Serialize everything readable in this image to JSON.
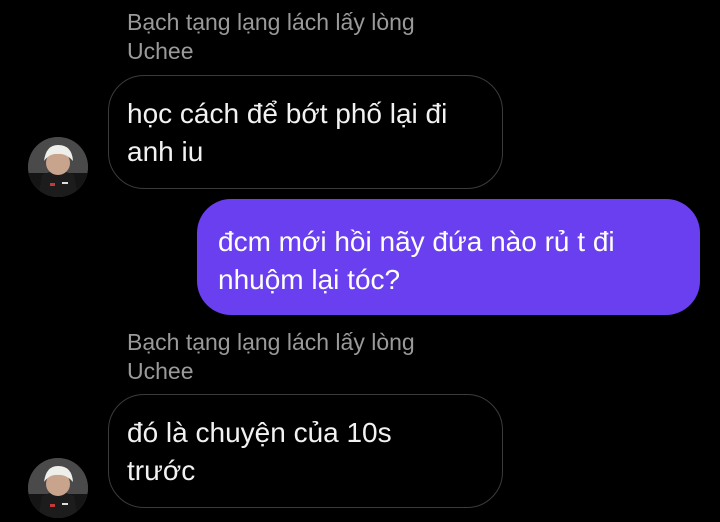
{
  "colors": {
    "background": "#000000",
    "sender_text": "#9a9a9a",
    "incoming_border": "#3b3b3b",
    "incoming_text": "#f2f2f2",
    "outgoing_bubble": "#6a3ff0",
    "outgoing_text": "#ffffff"
  },
  "messages": [
    {
      "direction": "incoming",
      "sender_line1": "Bạch tạng lạng lách lấy lòng",
      "sender_line2": "Uchee",
      "lines": [
        "học cách để bớt phố lại đi",
        "anh iu"
      ],
      "avatar_icon": "profile-avatar"
    },
    {
      "direction": "outgoing",
      "lines": [
        "đcm mới hồi nãy đứa nào rủ t đi",
        "nhuộm lại tóc?"
      ]
    },
    {
      "direction": "incoming",
      "sender_line1": "Bạch tạng lạng lách lấy lòng",
      "sender_line2": "Uchee",
      "lines": [
        "đó là chuyện của 10s",
        "trước"
      ],
      "avatar_icon": "profile-avatar"
    }
  ]
}
